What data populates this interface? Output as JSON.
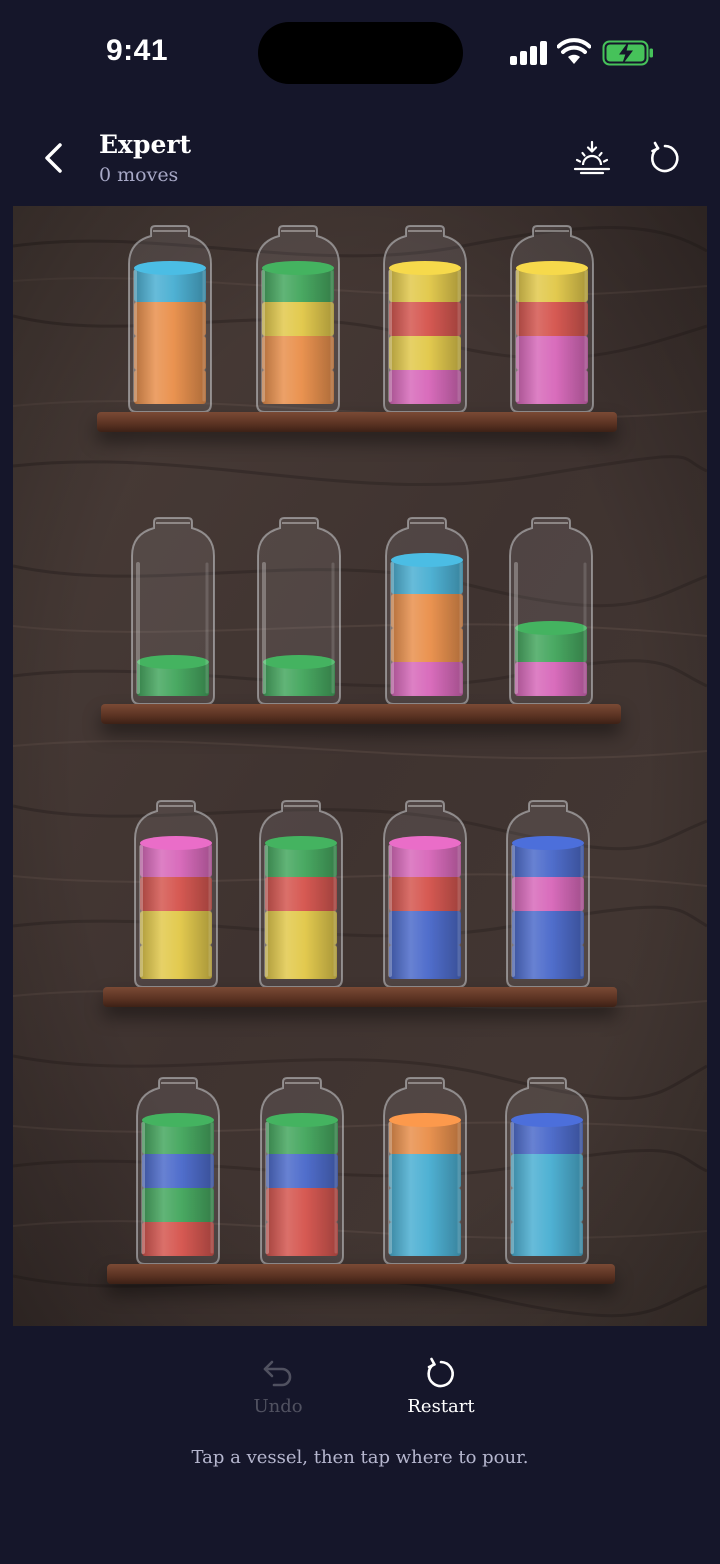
{
  "status_bar": {
    "time": "9:41"
  },
  "header": {
    "title": "Expert",
    "moves": "0 moves"
  },
  "colors": {
    "cyan": "#35a8cf",
    "orange": "#ea8435",
    "green": "#2e9e4a",
    "yellow": "#e2c534",
    "red": "#d34138",
    "pink": "#d657b3",
    "blue": "#3659c6"
  },
  "shelves": [
    {
      "bottles": [
        [
          "orange",
          "orange",
          "orange",
          "cyan"
        ],
        [
          "orange",
          "orange",
          "yellow",
          "green"
        ],
        [
          "pink",
          "yellow",
          "red",
          "yellow"
        ],
        [
          "pink",
          "pink",
          "red",
          "yellow"
        ]
      ]
    },
    {
      "bottles": [
        [
          "green"
        ],
        [
          "green"
        ],
        [
          "pink",
          "orange",
          "orange",
          "cyan"
        ],
        [
          "pink",
          "green"
        ]
      ]
    },
    {
      "bottles": [
        [
          "yellow",
          "yellow",
          "red",
          "pink"
        ],
        [
          "yellow",
          "yellow",
          "red",
          "green"
        ],
        [
          "blue",
          "blue",
          "red",
          "pink"
        ],
        [
          "blue",
          "blue",
          "pink",
          "blue"
        ]
      ]
    },
    {
      "bottles": [
        [
          "red",
          "green",
          "blue",
          "green"
        ],
        [
          "red",
          "red",
          "blue",
          "green"
        ],
        [
          "cyan",
          "cyan",
          "cyan",
          "orange"
        ],
        [
          "cyan",
          "cyan",
          "cyan",
          "blue"
        ]
      ]
    }
  ],
  "controls": {
    "undo_label": "Undo",
    "restart_label": "Restart",
    "undo_enabled": false
  },
  "instruction": "Tap a vessel, then tap where to pour."
}
